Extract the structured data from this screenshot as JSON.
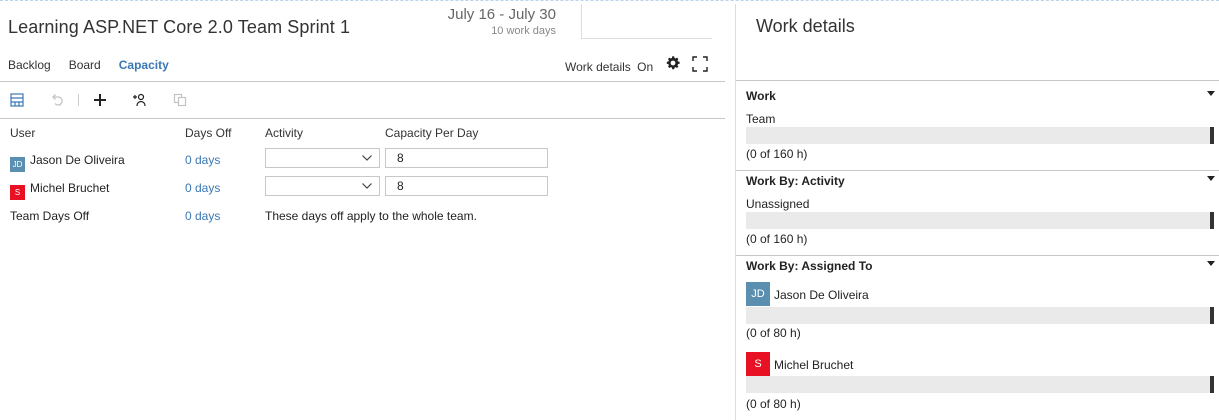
{
  "header": {
    "sprint_title": "Learning ASP.NET Core 2.0 Team Sprint 1",
    "dates": "July 16 - July 30",
    "work_days": "10 work days"
  },
  "nav": {
    "tabs": [
      {
        "label": "Backlog",
        "active": false
      },
      {
        "label": "Board",
        "active": false
      },
      {
        "label": "Capacity",
        "active": true
      }
    ],
    "work_details_label": "Work details",
    "work_details_state": "On"
  },
  "toolbar": {
    "icons": [
      "capacity-view-icon",
      "undo-icon",
      "add-icon",
      "add-all-members-icon",
      "copy-icon"
    ]
  },
  "table": {
    "headers": {
      "user": "User",
      "days_off": "Days Off",
      "activity": "Activity",
      "capacity": "Capacity Per Day"
    },
    "rows": [
      {
        "user": "Jason De Oliveira",
        "avatar_text": "JD",
        "avatar_color": "#5a8fb0",
        "days_off": "0 days",
        "activity": "",
        "capacity": "8"
      },
      {
        "user": "Michel Bruchet",
        "avatar_text": "S",
        "avatar_color": "#e81123",
        "days_off": "0 days",
        "activity": "",
        "capacity": "8"
      }
    ],
    "team_days_off": {
      "label": "Team Days Off",
      "days_off": "0 days",
      "note": "These days off apply to the whole team."
    }
  },
  "work_details": {
    "title": "Work details",
    "sections": [
      {
        "heading": "Work",
        "items": [
          {
            "label": "Team",
            "capacity": "(0 of 160 h)"
          }
        ]
      },
      {
        "heading": "Work By: Activity",
        "items": [
          {
            "label": "Unassigned",
            "capacity": "(0 of 160 h)"
          }
        ]
      },
      {
        "heading": "Work By: Assigned To",
        "items": [
          {
            "label": "Jason De Oliveira",
            "avatar_text": "JD",
            "avatar_color": "#5a8fb0",
            "capacity": "(0 of 80 h)"
          },
          {
            "label": "Michel Bruchet",
            "avatar_text": "S",
            "avatar_color": "#e81123",
            "capacity": "(0 of 80 h)"
          }
        ]
      }
    ]
  },
  "colors": {
    "accent": "#3a78b5",
    "divider": "#c8c8c8",
    "bar_bg": "#eaeaea"
  }
}
